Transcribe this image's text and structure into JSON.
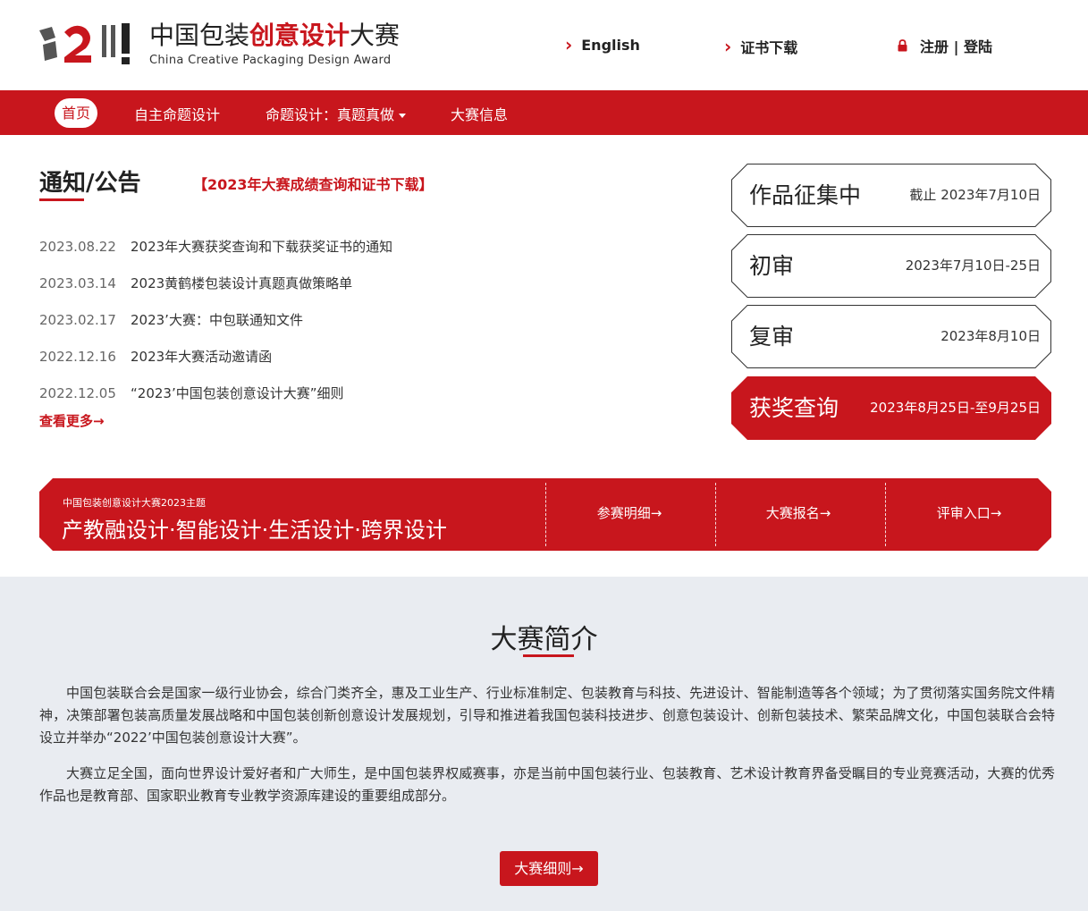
{
  "header": {
    "logo_cn_prefix": "中国包装",
    "logo_cn_red": "创意设计",
    "logo_cn_suffix": "大赛",
    "logo_en": "China Creative Packaging Design Award",
    "links": {
      "english": "English",
      "certificate": "证书下载",
      "auth": "注册 | 登陆"
    }
  },
  "nav": {
    "items": [
      {
        "label": "首页"
      },
      {
        "label": "自主命题设计"
      },
      {
        "label": "命题设计：真题真做"
      },
      {
        "label": "大赛信息"
      }
    ]
  },
  "notices": {
    "title": "通知/公告",
    "highlight": "【2023年大赛成绩查询和证书下载】",
    "items": [
      {
        "date": "2023.08.22",
        "text": "2023年大赛获奖查询和下载获奖证书的通知"
      },
      {
        "date": "2023.03.14",
        "text": "2023黄鹤楼包装设计真题真做策略单"
      },
      {
        "date": "2023.02.17",
        "text": "2023’大赛：中包联通知文件"
      },
      {
        "date": "2022.12.16",
        "text": "2023年大赛活动邀请函"
      },
      {
        "date": "2022.12.05",
        "text": "“2023’中国包装创意设计大赛”细则"
      }
    ],
    "more": "查看更多→"
  },
  "timeline": [
    {
      "title": "作品征集中",
      "date": "截止 2023年7月10日"
    },
    {
      "title": "初审",
      "date": "2023年7月10日-25日"
    },
    {
      "title": "复审",
      "date": "2023年8月10日"
    },
    {
      "title": "获奖查询",
      "date": "2023年8月25日-至9月25日"
    }
  ],
  "banner": {
    "small": "中国包装创意设计大赛2023主题",
    "big": "产教融设计·智能设计·生活设计·跨界设计",
    "links": [
      "参赛明细→",
      "大赛报名→",
      "评审入口→"
    ]
  },
  "intro": {
    "title": "大赛简介",
    "para1": "中国包装联合会是国家一级行业协会，综合门类齐全，惠及工业生产、行业标准制定、包装教育与科技、先进设计、智能制造等各个领域；为了贯彻落实国务院文件精神，决策部署包装高质量发展战略和中国包装创新创意设计发展规划，引导和推进着我国包装科技进步、创意包装设计、创新包装技术、繁荣品牌文化，中国包装联合会特设立并举办“2022’中国包装创意设计大赛”。",
    "para2": "大赛立足全国，面向世界设计爱好者和广大师生，是中国包装界权威赛事，亦是当前中国包装行业、包装教育、艺术设计教育界备受瞩目的专业竞赛活动，大赛的优秀作品也是教育部、国家职业教育专业教学资源库建设的重要组成部分。",
    "button": "大赛细则→"
  },
  "colors": {
    "brand_red": "#c8161d",
    "intro_bg": "#e9ecf1"
  }
}
